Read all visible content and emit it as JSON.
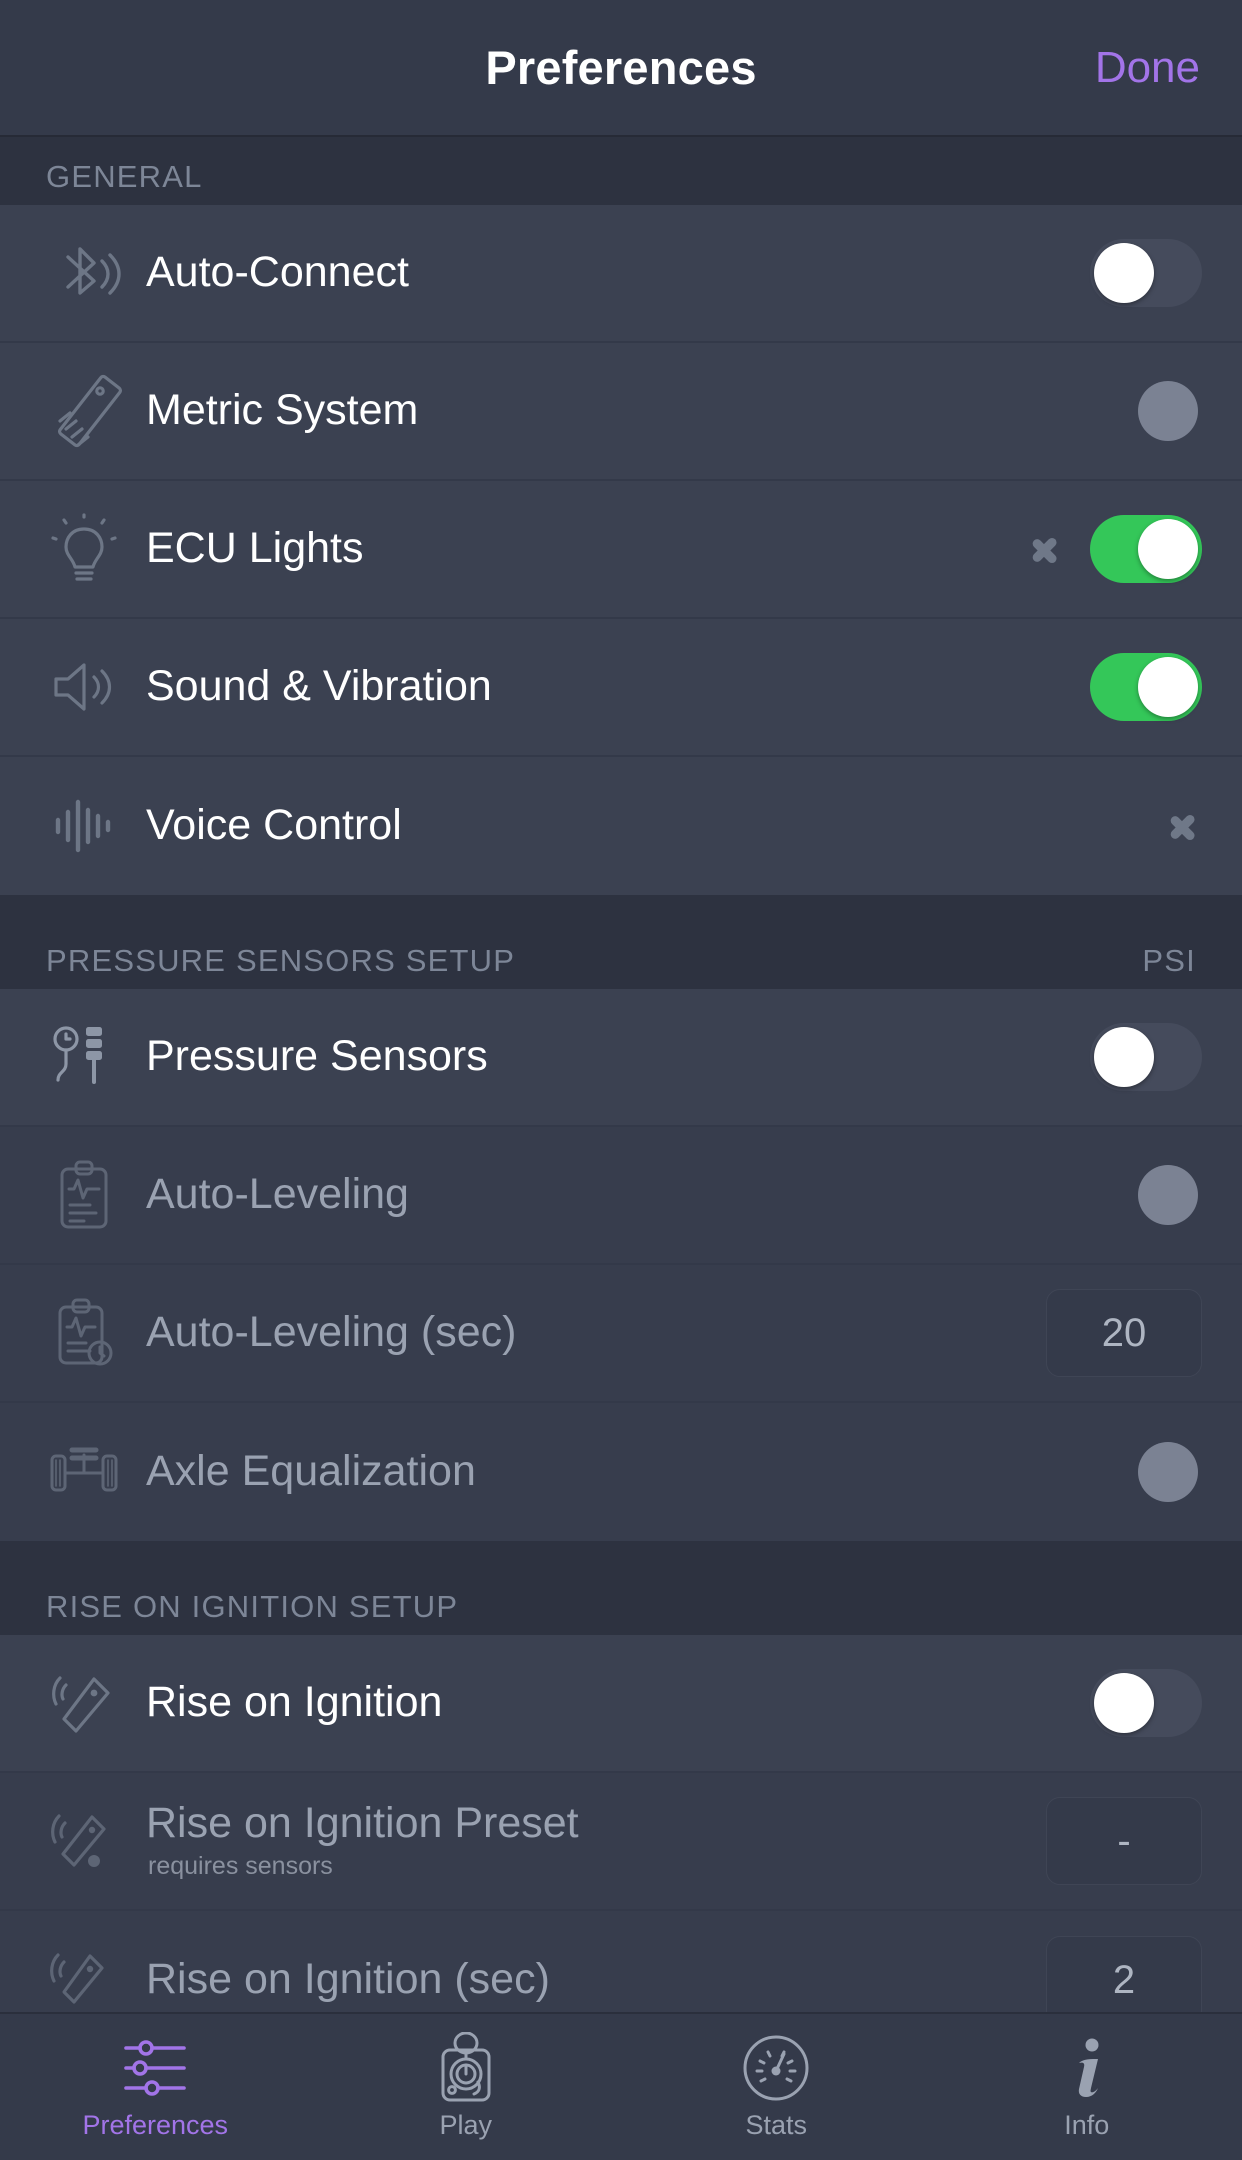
{
  "header": {
    "title": "Preferences",
    "done_label": "Done",
    "done_color": "#a274e8"
  },
  "sections": [
    {
      "title": "GENERAL",
      "right_label": "",
      "rows": [
        {
          "icon": "bluetooth-icon",
          "label": "Auto-Connect",
          "sub": "",
          "control": "toggle-off",
          "chevron": false,
          "dim": false
        },
        {
          "icon": "ruler-icon",
          "label": "Metric System",
          "sub": "",
          "control": "toggle-disabled",
          "chevron": false,
          "dim": false
        },
        {
          "icon": "lightbulb-icon",
          "label": "ECU Lights",
          "sub": "",
          "control": "toggle-on",
          "chevron": true,
          "dim": false
        },
        {
          "icon": "speaker-icon",
          "label": "Sound & Vibration",
          "sub": "",
          "control": "toggle-on",
          "chevron": false,
          "dim": false
        },
        {
          "icon": "waveform-icon",
          "label": "Voice Control",
          "sub": "",
          "control": "none",
          "chevron": true,
          "dim": false
        }
      ]
    },
    {
      "title": "PRESSURE SENSORS SETUP",
      "right_label": "PSI",
      "rows": [
        {
          "icon": "pressure-sensor-icon",
          "label": "Pressure Sensors",
          "sub": "",
          "control": "toggle-off",
          "chevron": false,
          "dim": false
        },
        {
          "icon": "clipboard-ecg-icon",
          "label": "Auto-Leveling",
          "sub": "",
          "control": "toggle-disabled",
          "chevron": false,
          "dim": true
        },
        {
          "icon": "clipboard-timer-icon",
          "label": "Auto-Leveling (sec)",
          "sub": "",
          "control": "value",
          "value": "20",
          "chevron": false,
          "dim": true
        },
        {
          "icon": "axle-icon",
          "label": "Axle Equalization",
          "sub": "",
          "control": "toggle-disabled",
          "chevron": false,
          "dim": true
        }
      ]
    },
    {
      "title": "RISE ON IGNITION SETUP",
      "right_label": "",
      "rows": [
        {
          "icon": "key-fob-icon",
          "label": "Rise on Ignition",
          "sub": "",
          "control": "toggle-off",
          "chevron": false,
          "dim": false
        },
        {
          "icon": "key-fob-preset-icon",
          "label": "Rise on Ignition Preset",
          "sub": "requires sensors",
          "control": "value",
          "value": "-",
          "chevron": false,
          "dim": true
        },
        {
          "icon": "key-fob-timer-icon",
          "label": "Rise on Ignition (sec)",
          "sub": "",
          "control": "value",
          "value": "2",
          "chevron": false,
          "dim": true
        }
      ]
    }
  ],
  "tabbar": {
    "items": [
      {
        "icon": "sliders-icon",
        "label": "Preferences",
        "active": true
      },
      {
        "icon": "shifter-icon",
        "label": "Play",
        "active": false
      },
      {
        "icon": "gauge-icon",
        "label": "Stats",
        "active": false
      },
      {
        "icon": "info-icon",
        "label": "Info",
        "active": false
      }
    ]
  },
  "colors": {
    "accent": "#a274e8",
    "toggle_on": "#34c759",
    "row_bg": "#3b4151",
    "page_bg": "#2d3240"
  }
}
